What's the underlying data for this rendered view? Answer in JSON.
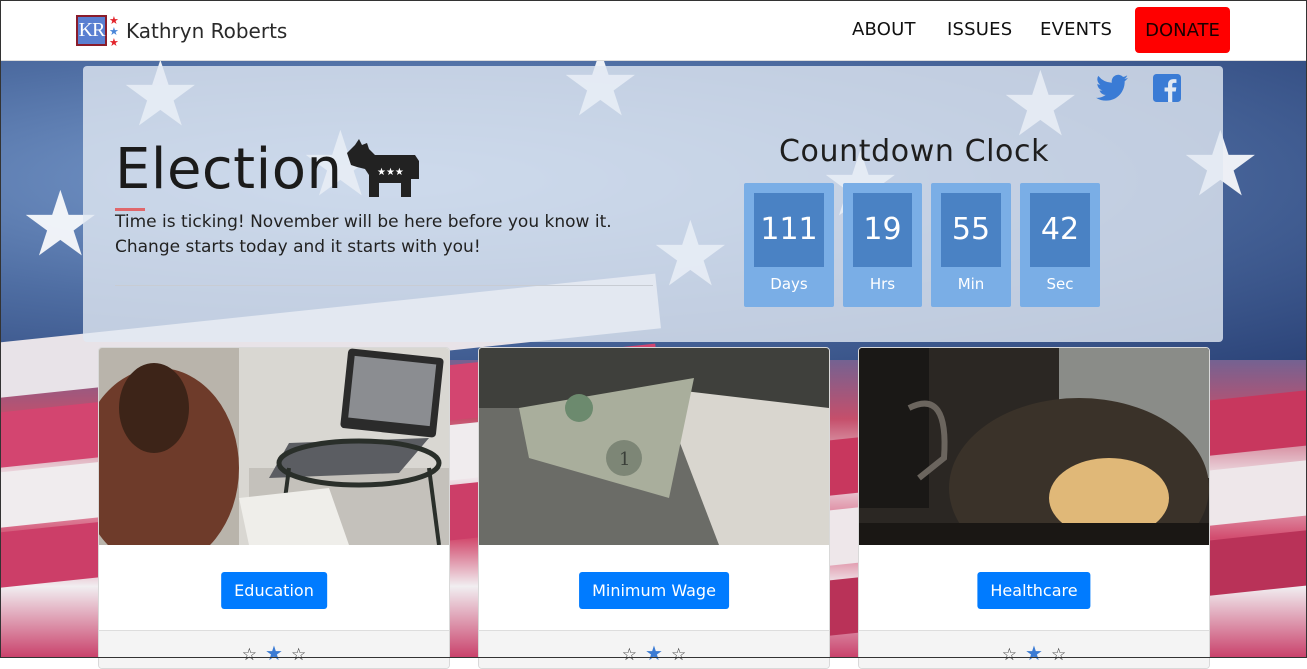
{
  "brand": {
    "logo_text": "KR",
    "name": "Kathryn Roberts"
  },
  "nav": {
    "about": "ABOUT",
    "issues": "ISSUES",
    "events": "EVENTS",
    "donate": "DONATE"
  },
  "hero": {
    "title": "Election",
    "line1": "Time is ticking! November will be here before you know it.",
    "line2": "Change starts today and it starts with you!",
    "social": [
      "twitter-icon",
      "facebook-icon"
    ]
  },
  "countdown": {
    "title": "Countdown Clock",
    "days": "111",
    "days_label": "Days",
    "hrs": "19",
    "hrs_label": "Hrs",
    "min": "55",
    "min_label": "Min",
    "sec": "42",
    "sec_label": "Sec"
  },
  "cards": [
    {
      "button": "Education",
      "image": "student-laptop-photo",
      "rating": 2
    },
    {
      "button": "Minimum Wage",
      "image": "dollar-bill-photo",
      "rating": 2
    },
    {
      "button": "Healthcare",
      "image": "mug-face-mask-photo",
      "rating": 2
    }
  ],
  "colors": {
    "donate": "#ff0000",
    "primary": "#007bff",
    "countdown_box": "#7aaee6",
    "countdown_num": "#4a82c4"
  }
}
